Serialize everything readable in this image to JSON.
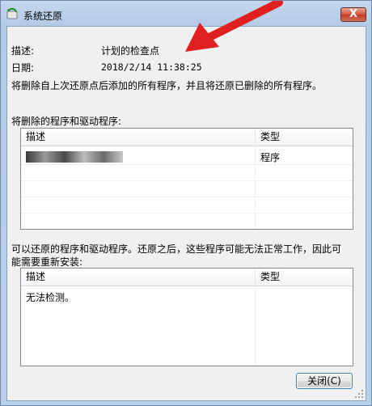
{
  "window": {
    "title": "系统还原",
    "close_glyph": "X"
  },
  "info": {
    "desc_label": "描述:",
    "desc_value": "计划的检查点",
    "date_label": "日期:",
    "date_value": "2018/2/14 11:38:25",
    "notice": "将删除自上次还原点后添加的所有程序，并且将还原已删除的所有程序。"
  },
  "deleted_section": {
    "label": "将删除的程序和驱动程序:",
    "columns": [
      "描述",
      "类型"
    ],
    "rows": [
      {
        "type": "程序"
      }
    ]
  },
  "restored_section": {
    "label_line1": "可以还原的程序和驱动程序。还原之后，这些程序可能无法正常工作，因此可",
    "label_line2": "能需要重新安装:",
    "columns": [
      "描述",
      "类型"
    ],
    "rows": [
      {
        "description": "无法检测。"
      }
    ]
  },
  "buttons": {
    "close_label": "关闭(C)"
  },
  "colors": {
    "arrow": "#e02020",
    "title_gradient_top": "#c4d7ee",
    "dialog_bg": "#f0f0f0",
    "close_button": "#c3371f"
  },
  "icons": [
    "system-restore-icon",
    "close-icon",
    "red-arrow-icon",
    "size-grip-icon"
  ]
}
